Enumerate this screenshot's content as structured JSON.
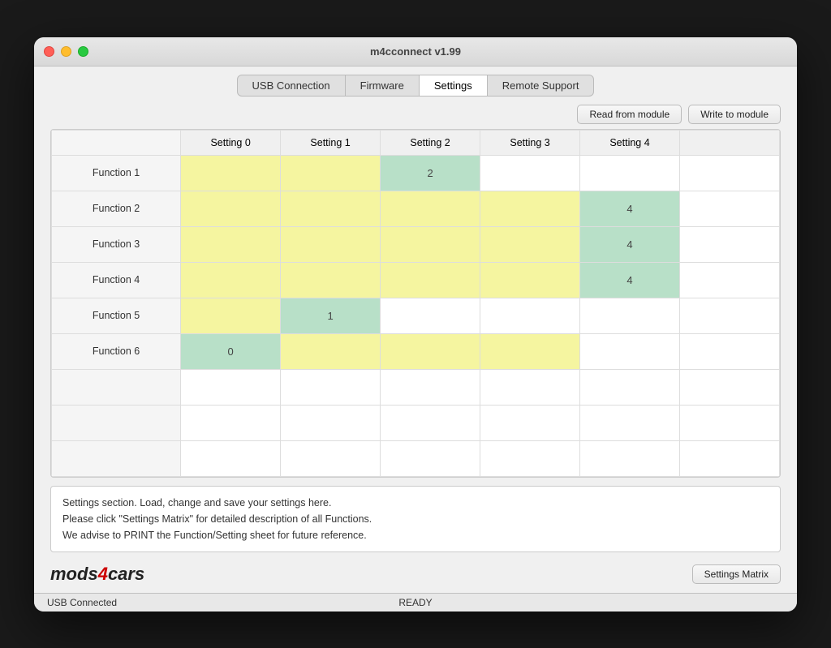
{
  "window": {
    "title": "m4cconnect v1.99"
  },
  "tabs": [
    {
      "id": "usb",
      "label": "USB Connection",
      "active": false
    },
    {
      "id": "firmware",
      "label": "Firmware",
      "active": false
    },
    {
      "id": "settings",
      "label": "Settings",
      "active": true
    },
    {
      "id": "remote",
      "label": "Remote Support",
      "active": false
    }
  ],
  "buttons": {
    "read_from_module": "Read from module",
    "write_to_module": "Write to module",
    "settings_matrix": "Settings Matrix"
  },
  "table": {
    "columns": [
      "Setting 0",
      "Setting 1",
      "Setting 2",
      "Setting 3",
      "Setting 4"
    ],
    "rows": [
      {
        "label": "Function 1",
        "cells": [
          {
            "bg": "yellow",
            "value": ""
          },
          {
            "bg": "yellow",
            "value": ""
          },
          {
            "bg": "green",
            "value": "2"
          },
          {
            "bg": "white",
            "value": ""
          },
          {
            "bg": "white",
            "value": ""
          }
        ]
      },
      {
        "label": "Function 2",
        "cells": [
          {
            "bg": "yellow",
            "value": ""
          },
          {
            "bg": "yellow",
            "value": ""
          },
          {
            "bg": "yellow",
            "value": ""
          },
          {
            "bg": "yellow",
            "value": ""
          },
          {
            "bg": "green",
            "value": "4"
          }
        ]
      },
      {
        "label": "Function 3",
        "cells": [
          {
            "bg": "yellow",
            "value": ""
          },
          {
            "bg": "yellow",
            "value": ""
          },
          {
            "bg": "yellow",
            "value": ""
          },
          {
            "bg": "yellow",
            "value": ""
          },
          {
            "bg": "green",
            "value": "4"
          }
        ]
      },
      {
        "label": "Function 4",
        "cells": [
          {
            "bg": "yellow",
            "value": ""
          },
          {
            "bg": "yellow",
            "value": ""
          },
          {
            "bg": "yellow",
            "value": ""
          },
          {
            "bg": "yellow",
            "value": ""
          },
          {
            "bg": "green",
            "value": "4"
          }
        ]
      },
      {
        "label": "Function 5",
        "cells": [
          {
            "bg": "yellow",
            "value": ""
          },
          {
            "bg": "green",
            "value": "1"
          },
          {
            "bg": "white",
            "value": ""
          },
          {
            "bg": "white",
            "value": ""
          },
          {
            "bg": "white",
            "value": ""
          }
        ]
      },
      {
        "label": "Function 6",
        "cells": [
          {
            "bg": "green",
            "value": "0"
          },
          {
            "bg": "yellow",
            "value": ""
          },
          {
            "bg": "yellow",
            "value": ""
          },
          {
            "bg": "yellow",
            "value": ""
          },
          {
            "bg": "white",
            "value": ""
          }
        ]
      }
    ]
  },
  "info": {
    "line1": "Settings section. Load, change and save your settings here.",
    "line2": "Please click \"Settings Matrix\" for detailed description of all Functions.",
    "line3": "We advise to PRINT the Function/Setting sheet for future reference."
  },
  "logo": {
    "text_black": "mods",
    "text_red": "4",
    "text_black2": "cars"
  },
  "status_bar": {
    "left": "USB Connected",
    "center": "READY",
    "right": ""
  }
}
